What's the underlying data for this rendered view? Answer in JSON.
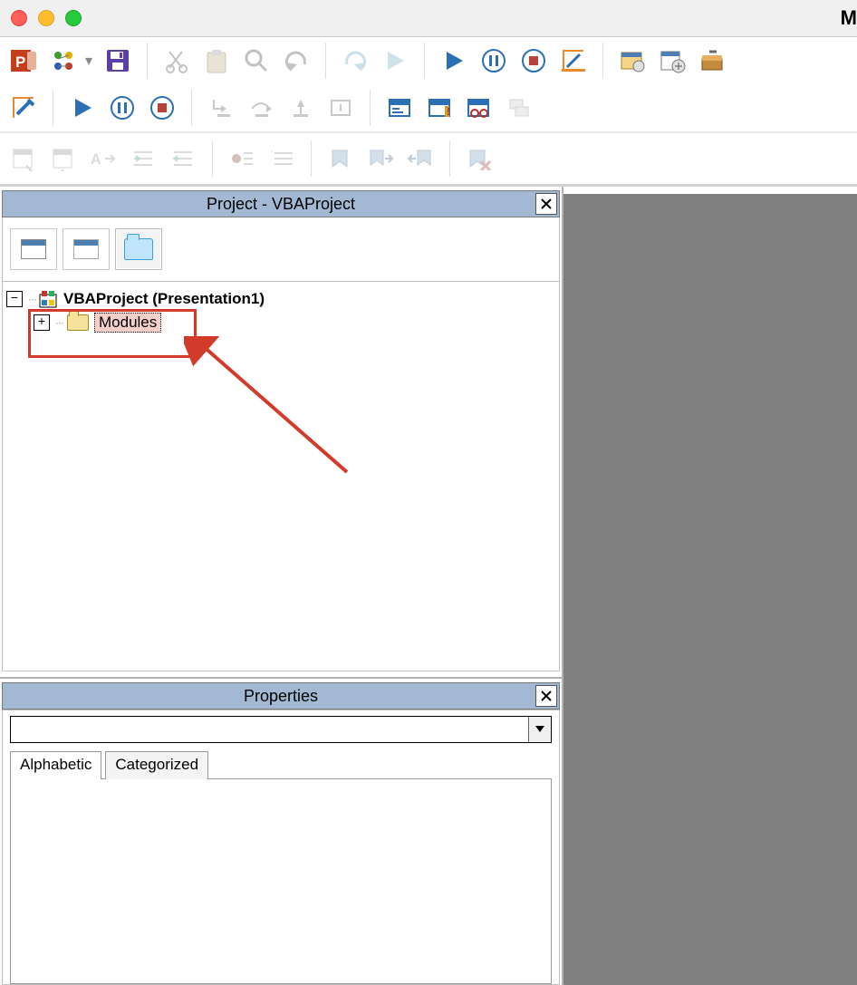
{
  "window": {
    "title_fragment": "M"
  },
  "project_panel": {
    "title": "Project - VBAProject",
    "root_label": "VBAProject (Presentation1)",
    "modules_label": "Modules"
  },
  "properties_panel": {
    "title": "Properties",
    "tab_alpha": "Alphabetic",
    "tab_cat": "Categorized",
    "combo_value": ""
  }
}
